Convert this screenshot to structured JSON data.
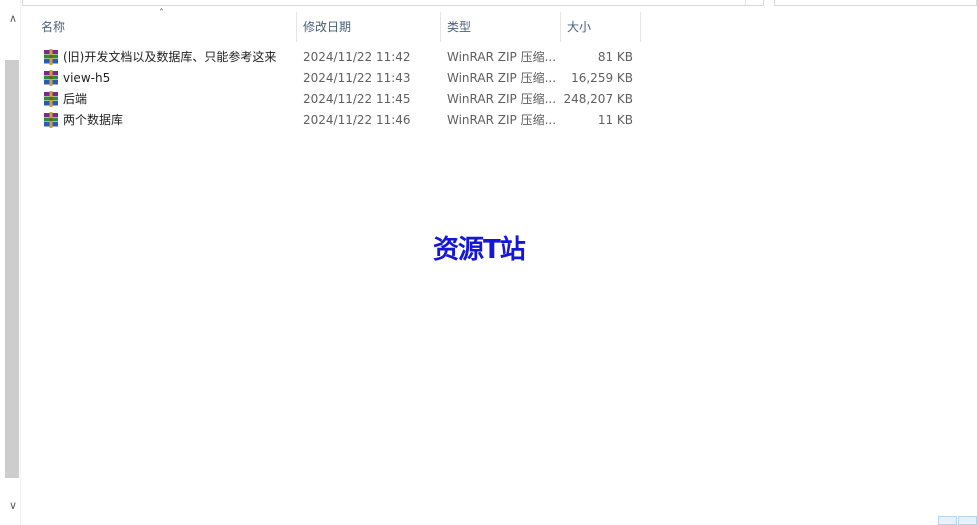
{
  "columns": {
    "name": "名称",
    "date": "修改日期",
    "type": "类型",
    "size": "大小"
  },
  "files": [
    {
      "name": "(旧)开发文档以及数据库、只能参考这来",
      "date": "2024/11/22 11:42",
      "type": "WinRAR ZIP 压缩...",
      "size": "81 KB",
      "icon": "winrar-archive-icon"
    },
    {
      "name": "view-h5",
      "date": "2024/11/22 11:43",
      "type": "WinRAR ZIP 压缩...",
      "size": "16,259 KB",
      "icon": "winrar-archive-icon"
    },
    {
      "name": "后端",
      "date": "2024/11/22 11:45",
      "type": "WinRAR ZIP 压缩...",
      "size": "248,207 KB",
      "icon": "winrar-archive-icon"
    },
    {
      "name": "两个数据库",
      "date": "2024/11/22 11:46",
      "type": "WinRAR ZIP 压缩...",
      "size": "11 KB",
      "icon": "winrar-archive-icon"
    }
  ],
  "watermark": "资源T站",
  "colors": {
    "watermark": "#1616d8",
    "header_text": "#4c607a",
    "scrollbar": "#cdcdcd"
  }
}
